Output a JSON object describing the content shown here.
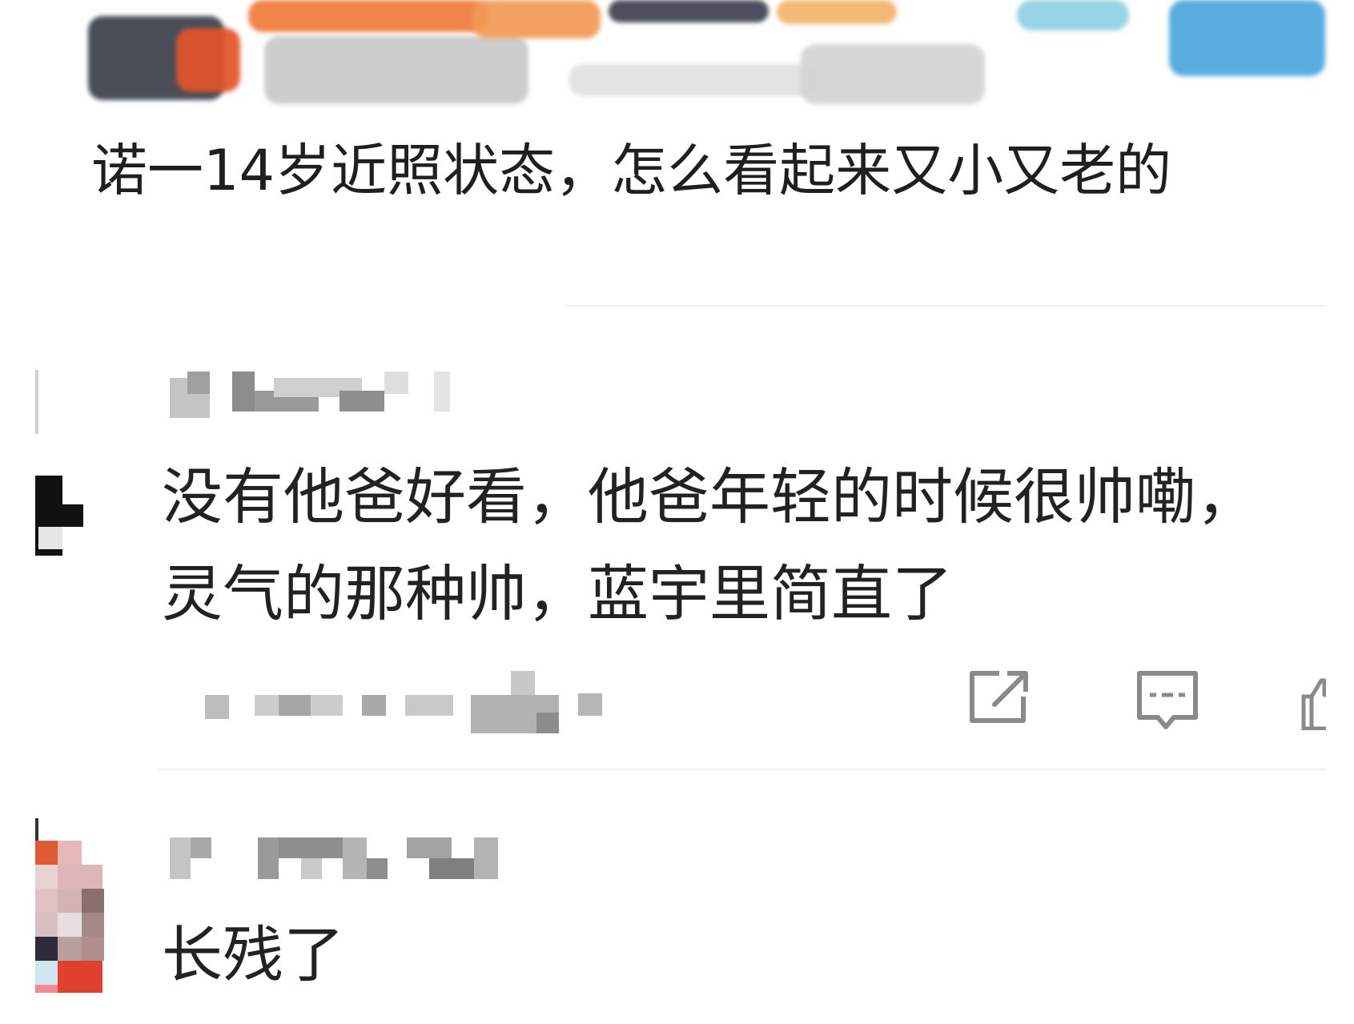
{
  "post": {
    "text": "诺一14岁近照状态，怎么看起来又小又老的"
  },
  "comments": [
    {
      "author": "",
      "lines": [
        "没有他爸好看，他爸年轻的时候很帅嘞，",
        "灵气的那种帅，蓝宇里简直了"
      ],
      "meta": ""
    },
    {
      "author": "",
      "lines": [
        "长残了"
      ],
      "meta": ""
    }
  ],
  "actions": {
    "share_icon": "share-icon",
    "reply_icon": "reply-icon",
    "like_icon": "thumbs-up-icon"
  },
  "colors": {
    "text": "#1f1f1f",
    "icon": "#8a8a8a",
    "divider": "#ededed"
  }
}
